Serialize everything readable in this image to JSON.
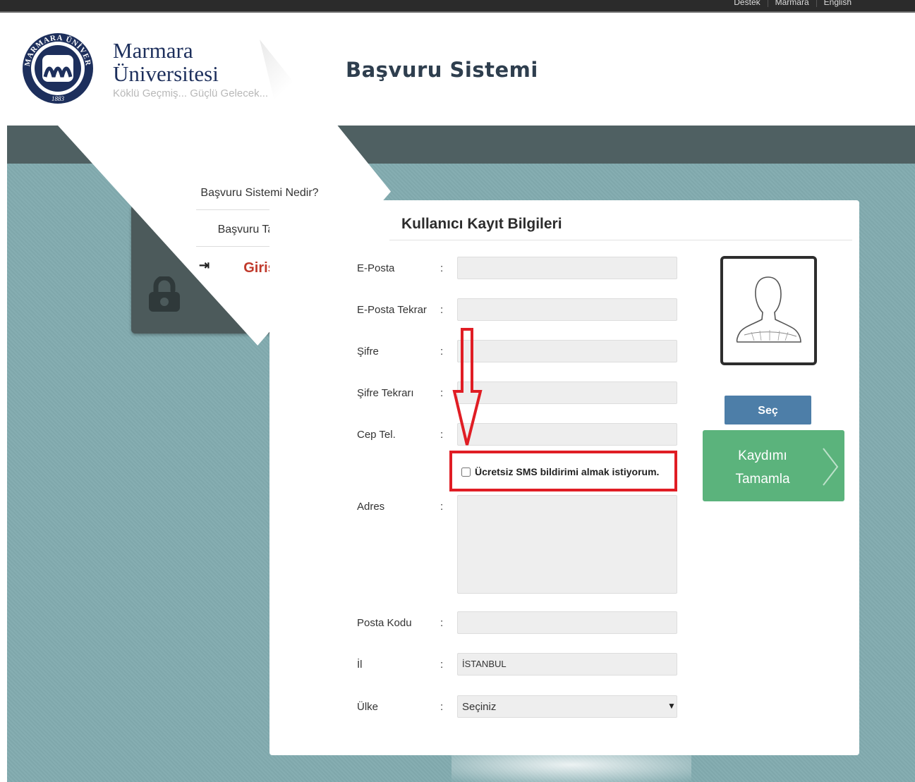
{
  "top_links": [
    "Destek",
    "Marmara",
    "English"
  ],
  "brand": {
    "line1": "Marmara",
    "line2": "Üniversitesi",
    "slogan": "Köklü Geçmiş... Güçlü Gelecek...",
    "seal_text": "MARMARA ÜNİVERSİTESİ",
    "seal_year": "1883"
  },
  "app_title": "Başvuru Sistemi",
  "menu": {
    "items": [
      {
        "label": "Başvuru Sistemi Nedir?"
      },
      {
        "label": "Başvuru Tarihleri"
      },
      {
        "label": "Giriş",
        "icon": "login-icon"
      }
    ]
  },
  "form": {
    "title": "Kullanıcı Kayıt Bilgileri",
    "colon": ":",
    "email": {
      "label": "E-Posta",
      "value": ""
    },
    "email_repeat": {
      "label": "E-Posta Tekrar",
      "value": ""
    },
    "password": {
      "label": "Şifre",
      "value": ""
    },
    "password_repeat": {
      "label": "Şifre Tekrarı",
      "value": ""
    },
    "phone": {
      "label": "Cep Tel.",
      "value": ""
    },
    "sms_optin": {
      "label": "Ücretsiz SMS bildirimi almak istiyorum.",
      "checked": false
    },
    "address": {
      "label": "Adres",
      "value": ""
    },
    "postal_code": {
      "label": "Posta Kodu",
      "value": ""
    },
    "city": {
      "label": "İl",
      "value": "İSTANBUL"
    },
    "country": {
      "label": "Ülke",
      "selected": "Seçiniz"
    }
  },
  "photo": {
    "select_label": "Seç",
    "placeholder_icon": "user-silhouette-icon"
  },
  "complete": {
    "line1": "Kaydımı",
    "line2": "Tamamla",
    "icon": "chevron-right-icon"
  },
  "colors": {
    "accent_red": "#c0392b",
    "highlight_red": "#e01d24",
    "button_blue": "#4d7ea8",
    "button_green": "#5bb37c",
    "band_dark": "#4f6062",
    "background_teal": "#82aaae"
  }
}
